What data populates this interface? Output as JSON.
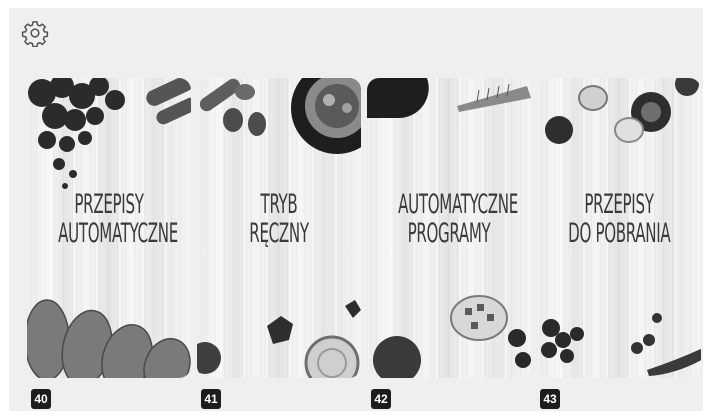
{
  "header": {
    "settings_icon": "gear-icon"
  },
  "tiles": [
    {
      "line1": "PRZEPISY",
      "line2": "AUTOMATYCZNE",
      "number": "40"
    },
    {
      "line1": "TRYB",
      "line2": "RĘCZNY",
      "number": "41"
    },
    {
      "line1": "AUTOMATYCZNE",
      "line2": "PROGRAMY",
      "number": "42"
    },
    {
      "line1": "PRZEPISY",
      "line2": "DO POBRANIA",
      "number": "43"
    }
  ],
  "colors": {
    "background": "#efefef",
    "badge": "#1d1d1d",
    "text": "#3a3a3a"
  }
}
